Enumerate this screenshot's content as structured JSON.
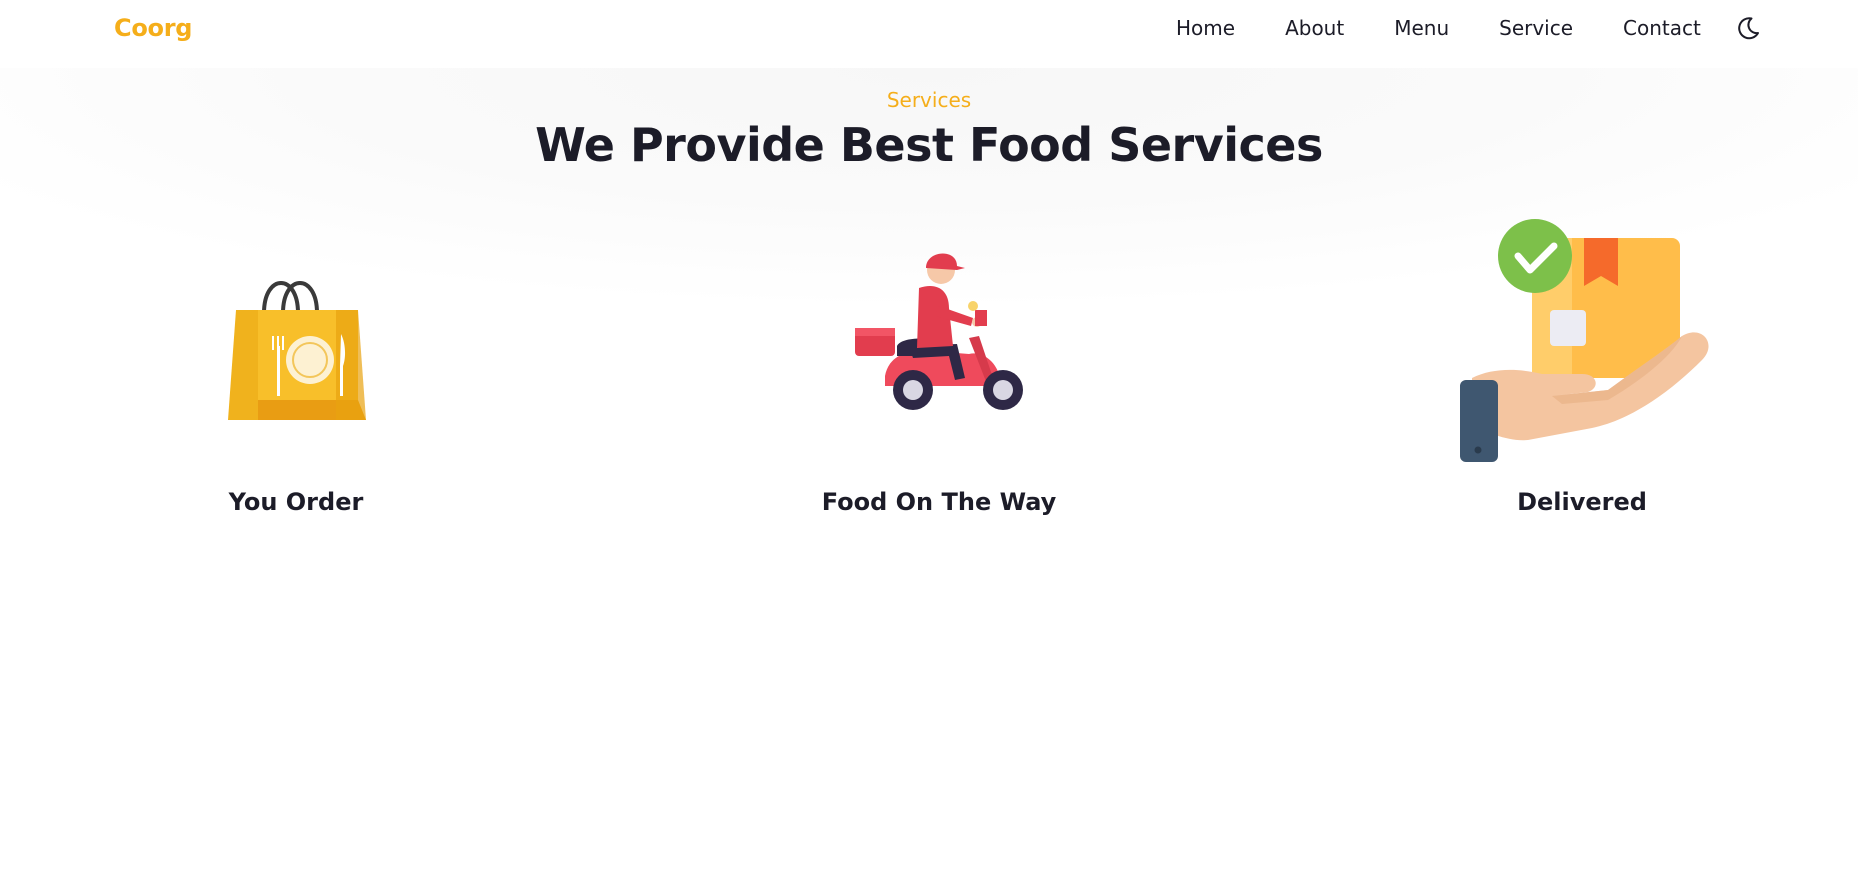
{
  "header": {
    "logo": "Coorg",
    "nav": [
      "Home",
      "About",
      "Menu",
      "Service",
      "Contact"
    ],
    "theme_icon": "moon-icon"
  },
  "services": {
    "subtitle": "Services",
    "title": "We Provide Best Food Services",
    "items": [
      {
        "label": "You Order",
        "icon": "shopping-bag-icon"
      },
      {
        "label": "Food On The Way",
        "icon": "delivery-scooter-icon"
      },
      {
        "label": "Delivered",
        "icon": "package-in-hand-icon"
      }
    ]
  },
  "colors": {
    "accent": "#f5ae1a",
    "text": "#1c1c28"
  }
}
